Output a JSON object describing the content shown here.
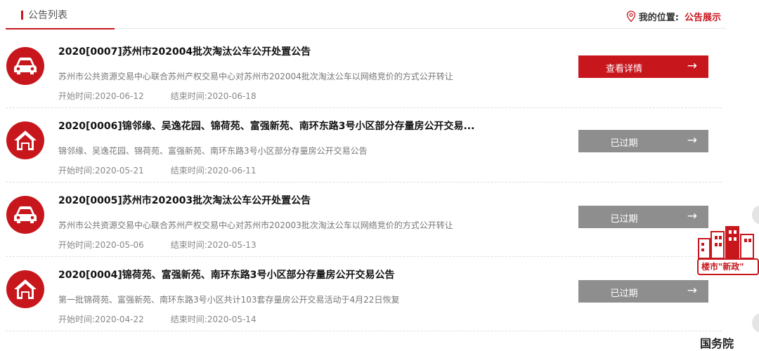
{
  "header": {
    "tab_label": "公告列表",
    "location_label": "我的位置:",
    "location_value": "公告展示"
  },
  "items": [
    {
      "icon": "car-icon",
      "title": "2020[0007]苏州市202004批次淘汰公车公开处置公告",
      "desc": "苏州市公共资源交易中心联合苏州产权交易中心对苏州市202004批次淘汰公车以网络竞价的方式公开转让",
      "start": "开始时间:2020-06-12",
      "end": "结束时间:2020-06-18",
      "button": "查看详情",
      "status": "active"
    },
    {
      "icon": "house-icon",
      "title": "2020[0006]锦邻缘、吴逸花园、锦荷苑、富强新苑、南环东路3号小区部分存量房公开交易...",
      "desc": "锦邻缘、吴逸花园、锦荷苑、富强新苑、南环东路3号小区部分存量房公开交易公告",
      "start": "开始时间:2020-05-21",
      "end": "结束时间:2020-06-11",
      "button": "已过期",
      "status": "expired"
    },
    {
      "icon": "car-icon",
      "title": "2020[0005]苏州市202003批次淘汰公车公开处置公告",
      "desc": "苏州市公共资源交易中心联合苏州产权交易中心对苏州市202003批次淘汰公车以网络竞价的方式公开转让",
      "start": "开始时间:2020-05-06",
      "end": "结束时间:2020-05-13",
      "button": "已过期",
      "status": "expired"
    },
    {
      "icon": "house-icon",
      "title": "2020[0004]锦荷苑、富强新苑、南环东路3号小区部分存量房公开交易公告",
      "desc": "第一批锦荷苑、富强新苑、南环东路3号小区共计103套存量房公开交易活动于4月22日恢复",
      "start": "开始时间:2020-04-22",
      "end": "结束时间:2020-05-14",
      "button": "已过期",
      "status": "expired"
    }
  ],
  "side": {
    "promo_label": "楼市\"新政\"",
    "promo2_label": "国务院"
  },
  "colors": {
    "accent": "#c8161d",
    "expired": "#8e8e8e"
  }
}
